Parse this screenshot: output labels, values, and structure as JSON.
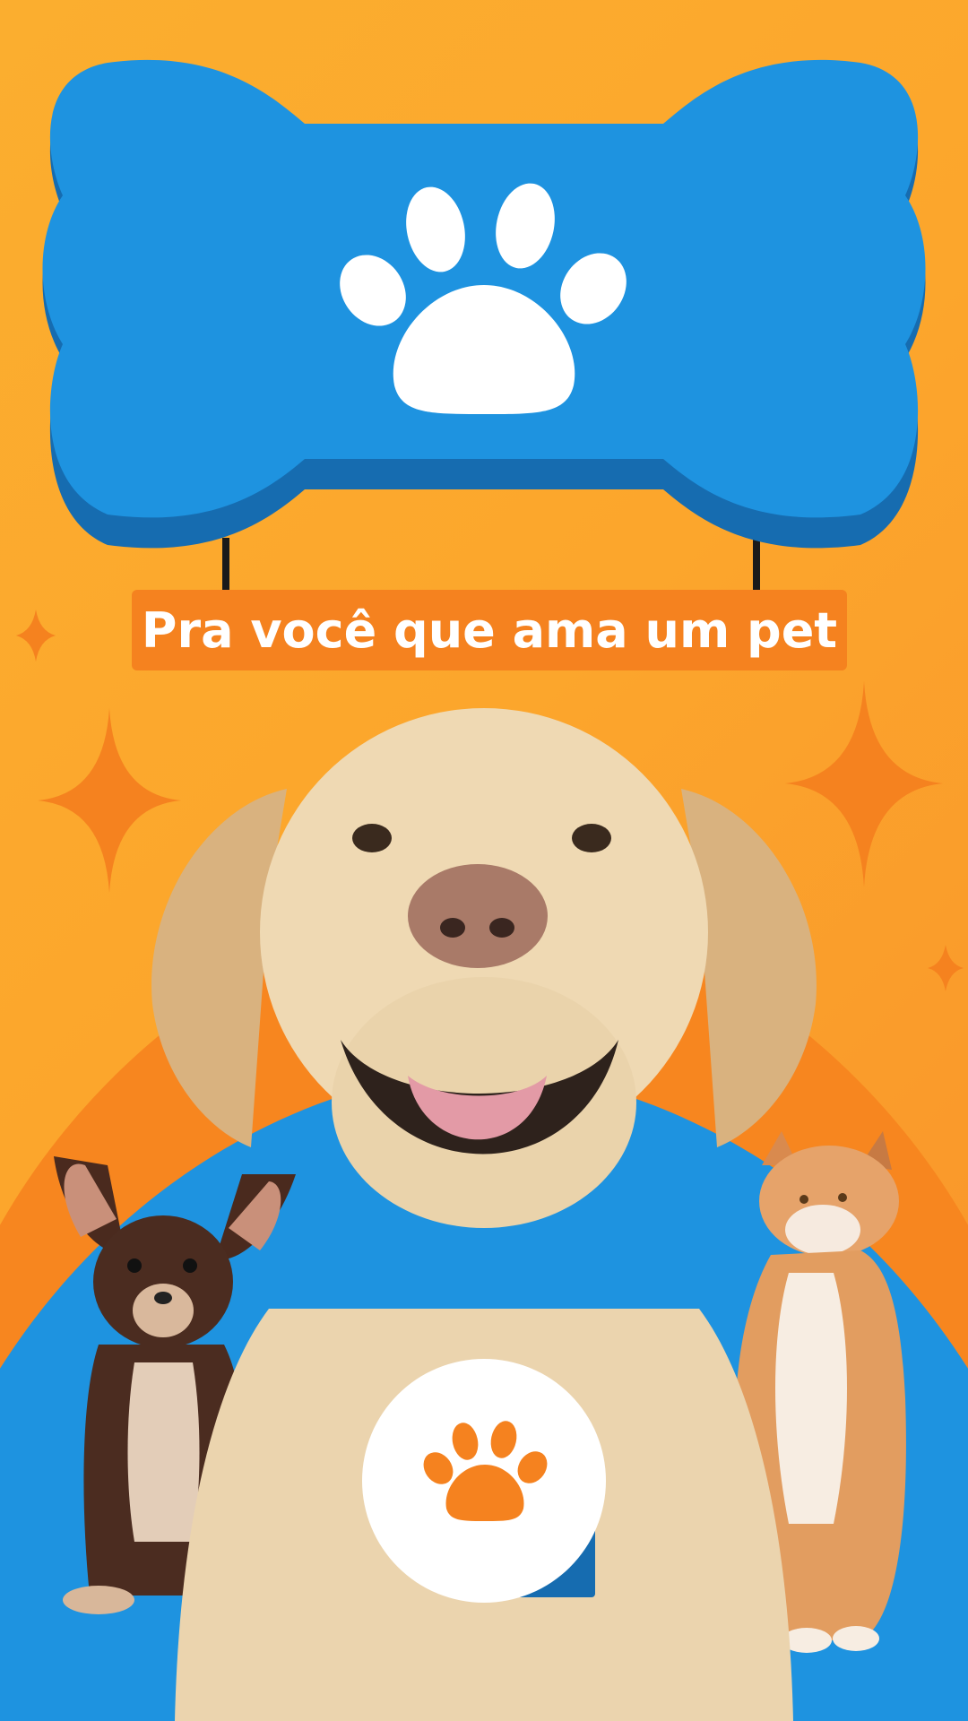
{
  "colors": {
    "background_orange": "#FCA62C",
    "arc_orange": "#F7861F",
    "blue": "#1E93E0",
    "blue_dark": "#166CB0",
    "banner_orange": "#F5821F",
    "white": "#FFFFFF"
  },
  "headline": "Pra você que ama um pet",
  "icons": [
    "paw-icon",
    "sparkle-icon",
    "bone-sign"
  ],
  "illustrations": [
    "labrador-dog",
    "chihuahua-puppy",
    "orange-cat"
  ]
}
